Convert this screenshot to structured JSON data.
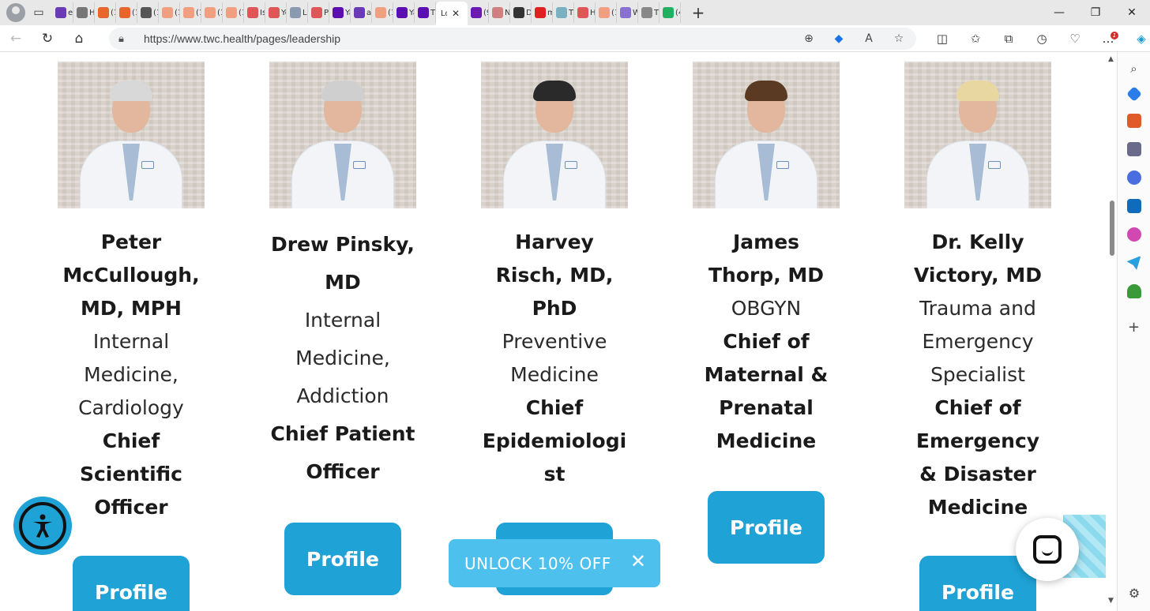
{
  "browser": {
    "tabs": [
      {
        "label": "ec",
        "favicon_color": "#6a3ab7"
      },
      {
        "label": "H",
        "favicon_color": "#777777"
      },
      {
        "label": "(1",
        "favicon_color": "#e8652b"
      },
      {
        "label": "(1",
        "favicon_color": "#e8652b"
      },
      {
        "label": "(1",
        "favicon_color": "#555555"
      },
      {
        "label": "(1",
        "favicon_color": "#f0a080"
      },
      {
        "label": "(1",
        "favicon_color": "#f0a080"
      },
      {
        "label": "(1",
        "favicon_color": "#f0a080"
      },
      {
        "label": "(1",
        "favicon_color": "#f0a080"
      },
      {
        "label": "Is",
        "favicon_color": "#e05555"
      },
      {
        "label": "Yo",
        "favicon_color": "#e05555"
      },
      {
        "label": "Lo",
        "favicon_color": "#8a9ab0"
      },
      {
        "label": "Pl",
        "favicon_color": "#e05555"
      },
      {
        "label": "Ya",
        "favicon_color": "#5b0fb0"
      },
      {
        "label": "al",
        "favicon_color": "#6a3ab7"
      },
      {
        "label": "(1",
        "favicon_color": "#f0a080"
      },
      {
        "label": "Ya",
        "favicon_color": "#5b0fb0"
      },
      {
        "label": "Tl",
        "favicon_color": "#5b0fb0"
      }
    ],
    "active_tab": {
      "label": "Lo",
      "close": "✕"
    },
    "tabs_after": [
      {
        "label": "(9",
        "favicon_color": "#6a1ab0"
      },
      {
        "label": "N",
        "favicon_color": "#d08080"
      },
      {
        "label": "D",
        "favicon_color": "#333333"
      },
      {
        "label": "m",
        "favicon_color": "#e02020"
      },
      {
        "label": "Tl",
        "favicon_color": "#7ab0c0"
      },
      {
        "label": "H",
        "favicon_color": "#e05555"
      },
      {
        "label": "(1",
        "favicon_color": "#f0a080"
      },
      {
        "label": "W",
        "favicon_color": "#8870d0"
      },
      {
        "label": "Tl",
        "favicon_color": "#888888"
      },
      {
        "label": "(4",
        "favicon_color": "#20b060"
      }
    ],
    "new_tab": "+",
    "window_controls": {
      "minimize": "—",
      "restore": "❐",
      "close": "✕"
    },
    "url": "https://www.twc.health/pages/leadership",
    "nav": {
      "back": "←",
      "refresh": "↻",
      "home": "⌂"
    },
    "notification_badge": "1"
  },
  "accent_color": "#1fa2d6",
  "leaders": [
    {
      "name_lines": [
        "Peter",
        "McCullough,",
        "MD, MPH"
      ],
      "specialty_lines": [
        "Internal",
        "Medicine,",
        "Cardiology"
      ],
      "title_lines": [
        "Chief",
        "Scientific",
        "Officer"
      ],
      "button": "Profile",
      "hair_color": "#d8d8d8"
    },
    {
      "name_lines": [
        "Drew Pinsky,",
        "MD"
      ],
      "specialty_lines": [
        "Internal",
        "Medicine,",
        "Addiction"
      ],
      "title_lines": [
        "Chief Patient",
        "Officer"
      ],
      "button": "Profile",
      "hair_color": "#cfcfcf"
    },
    {
      "name_lines": [
        "Harvey",
        "Risch, MD,",
        "PhD"
      ],
      "specialty_lines": [
        "Preventive",
        "Medicine"
      ],
      "title_lines": [
        "Chief",
        "Epidemiologi",
        "st"
      ],
      "button": "Profile",
      "hair_color": "#2a2a2a"
    },
    {
      "name_lines": [
        "James",
        "Thorp, MD"
      ],
      "specialty_lines": [
        "OBGYN"
      ],
      "title_lines": [
        "Chief of",
        "Maternal &",
        "Prenatal",
        "Medicine"
      ],
      "button": "Profile",
      "hair_color": "#5a3a22"
    },
    {
      "name_lines": [
        "Dr. Kelly",
        "Victory, MD"
      ],
      "specialty_lines": [
        "Trauma and",
        "Emergency",
        "Specialist"
      ],
      "title_lines": [
        "Chief of",
        "Emergency",
        "& Disaster",
        "Medicine"
      ],
      "button": "Profile",
      "hair_color": "#e8d7a0"
    }
  ],
  "promo": {
    "text": "UNLOCK 10% OFF",
    "close": "✕"
  },
  "icons": {
    "accessibility": "accessibility-icon",
    "chat": "chat-icon"
  }
}
